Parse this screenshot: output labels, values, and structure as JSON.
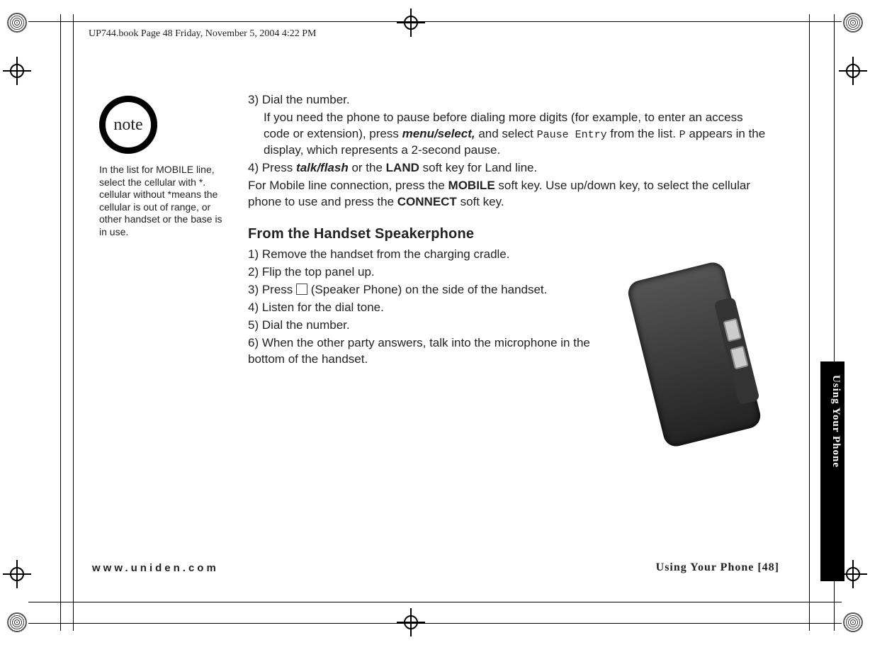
{
  "header": {
    "running_head": "UP744.book  Page 48  Friday, November 5, 2004  4:22 PM"
  },
  "note_icon_label": "note",
  "side_note": "In the list for MOBILE line, select the cellular with *. cellular without *means the cellular is out of range, or other handset or the base is in use.",
  "steps_a": {
    "s3_lead": "3) Dial the number.",
    "s3_body_a": "If you need the phone to pause before dialing more digits (for example, to enter an access code or extension), press ",
    "menu_select": "menu/select,",
    "s3_body_b": " and select ",
    "pause_entry": "Pause Entry",
    "s3_body_c": " from the list. ",
    "p_glyph": "P",
    "s3_body_d": " appears in the display, which represents a 2-second pause.",
    "s4_a": "4) Press ",
    "talk_flash": "talk/flash",
    "s4_b": " or the ",
    "land": "LAND",
    "s4_c": " soft key for Land line.",
    "mob_a": "For Mobile line connection, press the ",
    "mobile": "MOBILE",
    "mob_b": " soft key. Use up/down key, to select the cellular phone to use and press the ",
    "connect": "CONNECT",
    "mob_c": " soft key."
  },
  "section_heading": "From the Handset Speakerphone",
  "steps_b": {
    "s1": "1) Remove the handset from the charging cradle.",
    "s2": "2) Flip the top panel up.",
    "s3_a": "3) Press ",
    "s3_b": " (Speaker Phone) on the side of the handset.",
    "s4": "4) Listen for the dial tone.",
    "s5": "5) Dial the number.",
    "s6": "6) When the other party answers, talk into the microphone in the bottom of the handset."
  },
  "footer": {
    "url": "www.uniden.com",
    "right": "Using Your Phone  [48]"
  },
  "side_tab": "Using Your Phone"
}
